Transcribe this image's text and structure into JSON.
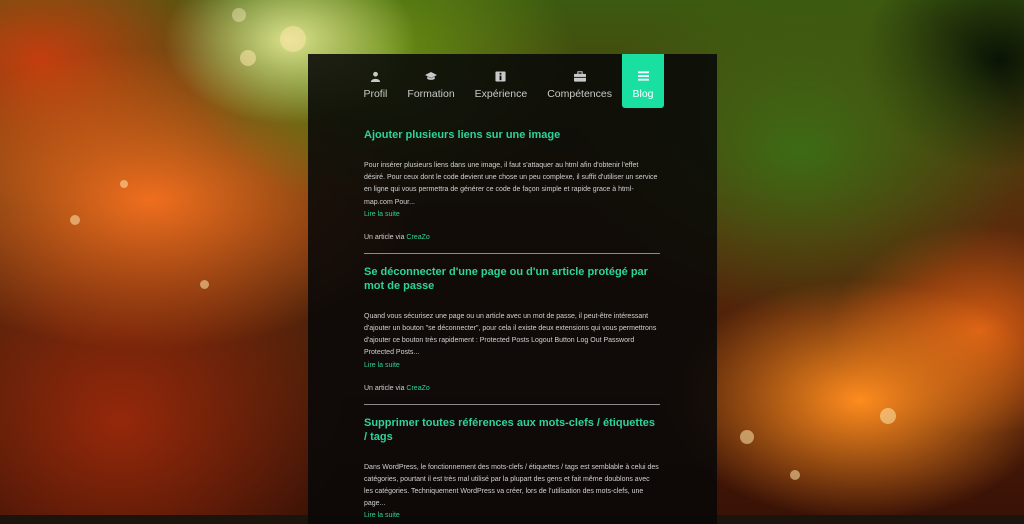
{
  "nav": {
    "items": [
      {
        "label": "Profil",
        "icon": "user-icon"
      },
      {
        "label": "Formation",
        "icon": "graduation-cap-icon"
      },
      {
        "label": "Expérience",
        "icon": "info-icon"
      },
      {
        "label": "Compétences",
        "icon": "briefcase-icon"
      },
      {
        "label": "Blog",
        "icon": "menu-icon",
        "active": true
      }
    ]
  },
  "colors": {
    "accent": "#19e0a0",
    "link": "#2ed39a",
    "panel": "rgba(8,8,8,0.88)"
  },
  "posts": [
    {
      "title": "Ajouter plusieurs liens sur une image",
      "excerpt": "Pour insérer plusieurs liens dans une image, il faut s'attaquer au html afin d'obtenir l'effet désiré. Pour ceux dont le code devient une chose un peu complexe, il suffit d'utiliser un service en ligne qui vous permettra de générer ce code de façon simple et rapide grace à html-map.com Pour...",
      "read_more": "Lire la suite",
      "via_prefix": "Un article via",
      "via_source": "CreaZo"
    },
    {
      "title": "Se déconnecter d'une page ou d'un article protégé par mot de passe",
      "excerpt": "Quand vous sécurisez une page ou un article avec un mot de passe, il peut-être intéressant d'ajouter un bouton \"se déconnecter\", pour cela il existe deux extensions qui vous permettrons d'ajouter ce bouton très rapidement : Protected Posts Logout Button Log Out Password Protected Posts...",
      "read_more": "Lire la suite",
      "via_prefix": "Un article via",
      "via_source": "CreaZo"
    },
    {
      "title": "Supprimer toutes références aux mots-clefs / étiquettes / tags",
      "excerpt": "Dans WordPress, le fonctionnement des mots-clefs / étiquettes / tags est semblable à celui des catégories, pourtant il est très mal utilisé par la plupart des gens et fait même doublons avec les catégories. Techniquement WordPress va créer, lors de l'utilisation des mots-clefs, une page...",
      "read_more": "Lire la suite"
    }
  ]
}
